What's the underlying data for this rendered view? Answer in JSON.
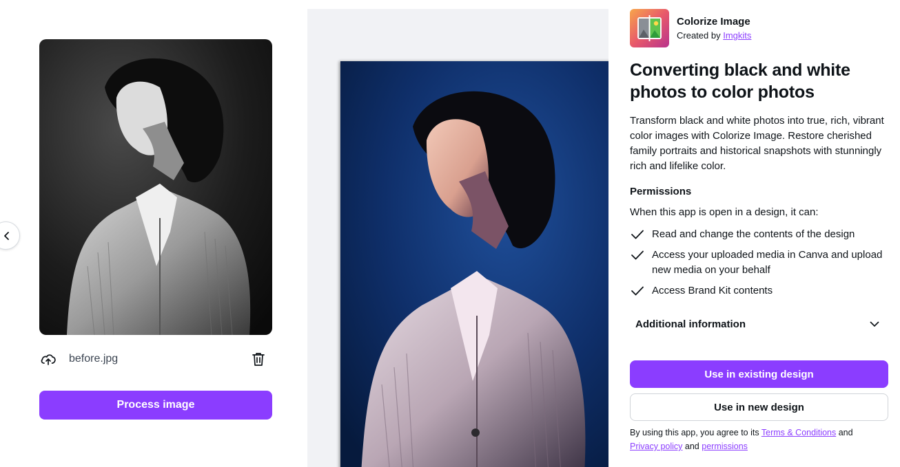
{
  "left_panel": {
    "file_name": "before.jpg",
    "process_button": "Process image"
  },
  "app": {
    "name": "Colorize Image",
    "created_by_prefix": "Created by",
    "creator": "Imgkits",
    "headline": "Converting black and white photos to color photos",
    "description": "Transform black and white photos into true, rich, vibrant color images with Colorize Image. Restore cherished family portraits and historical snapshots with stunningly rich and lifelike color.",
    "permissions_title": "Permissions",
    "permissions_intro": "When this app is open in a design, it can:",
    "permissions": [
      "Read and change the contents of the design",
      "Access your uploaded media in Canva and upload new media on your behalf",
      "Access Brand Kit contents"
    ],
    "additional_info": "Additional information",
    "use_existing_button": "Use in existing design",
    "use_new_button": "Use in new design",
    "terms": {
      "prefix": "By using this app, you agree to its",
      "terms_link": "Terms & Conditions",
      "and1": "and",
      "privacy_link": "Privacy policy",
      "and2": "and",
      "permissions_link": "permissions"
    }
  },
  "colors": {
    "accent": "#8b3dff",
    "preview_bg": "#f1f2f5"
  },
  "icons": {
    "prev": "chevron-left-icon",
    "upload": "cloud-upload-icon",
    "delete": "trash-icon",
    "check": "check-icon",
    "expand": "chevron-down-icon"
  }
}
